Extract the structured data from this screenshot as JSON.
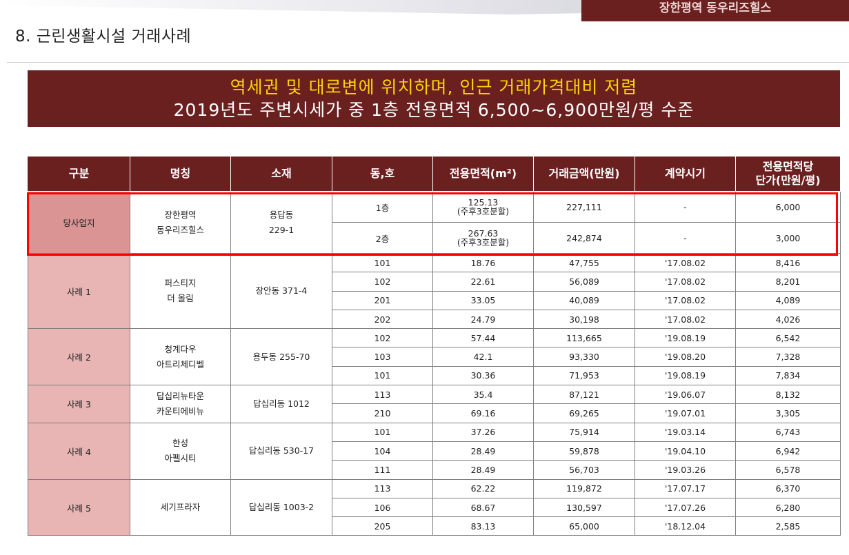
{
  "brand": "장한평역 동우리즈힐스",
  "title": "8. 근린생활시설 거래사례",
  "headline": {
    "line1": "역세권 및 대로변에 위치하며, 인근 거래가격대비 저렴",
    "line2": "2019년도 주변시세가 중 1층 전용면적 6,500~6,900만원/평 수준"
  },
  "table": {
    "headers": [
      "구분",
      "명칭",
      "소재",
      "동,호",
      "전용면적(m²)",
      "거래금액(만원)",
      "계약시기",
      "전용면적당\n단가(만원/평)"
    ],
    "site": {
      "category": "당사업지",
      "name1": "장한평역",
      "name2": "동우리즈힐스",
      "loc1": "용답동",
      "loc2": "229-1",
      "rows": [
        {
          "unit": "1층",
          "area": "125.13",
          "area_note": "(주후3호분할)",
          "price": "227,111",
          "date": "-",
          "unit_price": "6,000"
        },
        {
          "unit": "2층",
          "area": "267.63",
          "area_note": "(주후3호분할)",
          "price": "242,874",
          "date": "-",
          "unit_price": "3,000"
        }
      ]
    },
    "cases": [
      {
        "category": "사례 1",
        "name1": "퍼스티지",
        "name2": "더 올림",
        "location": "장안동 371-4",
        "rows": [
          {
            "unit": "101",
            "area": "18.76",
            "price": "47,755",
            "date": "'17.08.02",
            "unit_price": "8,416"
          },
          {
            "unit": "102",
            "area": "22.61",
            "price": "56,089",
            "date": "'17.08.02",
            "unit_price": "8,201"
          },
          {
            "unit": "201",
            "area": "33.05",
            "price": "40,089",
            "date": "'17.08.02",
            "unit_price": "4,089"
          },
          {
            "unit": "202",
            "area": "24.79",
            "price": "30,198",
            "date": "'17.08.02",
            "unit_price": "4,026"
          }
        ]
      },
      {
        "category": "사례 2",
        "name1": "청계다우",
        "name2": "아트리체디벨",
        "location": "용두동 255-70",
        "rows": [
          {
            "unit": "102",
            "area": "57.44",
            "price": "113,665",
            "date": "'19.08.19",
            "unit_price": "6,542"
          },
          {
            "unit": "103",
            "area": "42.1",
            "price": "93,330",
            "date": "'19.08.20",
            "unit_price": "7,328"
          },
          {
            "unit": "101",
            "area": "30.36",
            "price": "71,953",
            "date": "'19.08.19",
            "unit_price": "7,834"
          }
        ]
      },
      {
        "category": "사례 3",
        "name1": "답십리뉴타운",
        "name2": "카운티에비뉴",
        "location": "답십리동 1012",
        "rows": [
          {
            "unit": "113",
            "area": "35.4",
            "price": "87,121",
            "date": "'19.06.07",
            "unit_price": "8,132"
          },
          {
            "unit": "210",
            "area": "69.16",
            "price": "69,265",
            "date": "'19.07.01",
            "unit_price": "3,305"
          }
        ]
      },
      {
        "category": "사례 4",
        "name1": "한성",
        "name2": "아펠시티",
        "location": "답십리동 530-17",
        "rows": [
          {
            "unit": "101",
            "area": "37.26",
            "price": "75,914",
            "date": "'19.03.14",
            "unit_price": "6,743"
          },
          {
            "unit": "104",
            "area": "28.49",
            "price": "59,878",
            "date": "'19.04.10",
            "unit_price": "6,942"
          },
          {
            "unit": "111",
            "area": "28.49",
            "price": "56,703",
            "date": "'19.03.26",
            "unit_price": "6,578"
          }
        ]
      },
      {
        "category": "사례 5",
        "name1": "세기프라자",
        "name2": "",
        "location": "답십리동 1003-2",
        "rows": [
          {
            "unit": "113",
            "area": "62.22",
            "price": "119,872",
            "date": "'17.07.17",
            "unit_price": "6,370"
          },
          {
            "unit": "106",
            "area": "68.67",
            "price": "130,597",
            "date": "'17.07.26",
            "unit_price": "6,280"
          },
          {
            "unit": "205",
            "area": "83.13",
            "price": "65,000",
            "date": "'18.12.04",
            "unit_price": "2,585"
          }
        ]
      }
    ]
  }
}
